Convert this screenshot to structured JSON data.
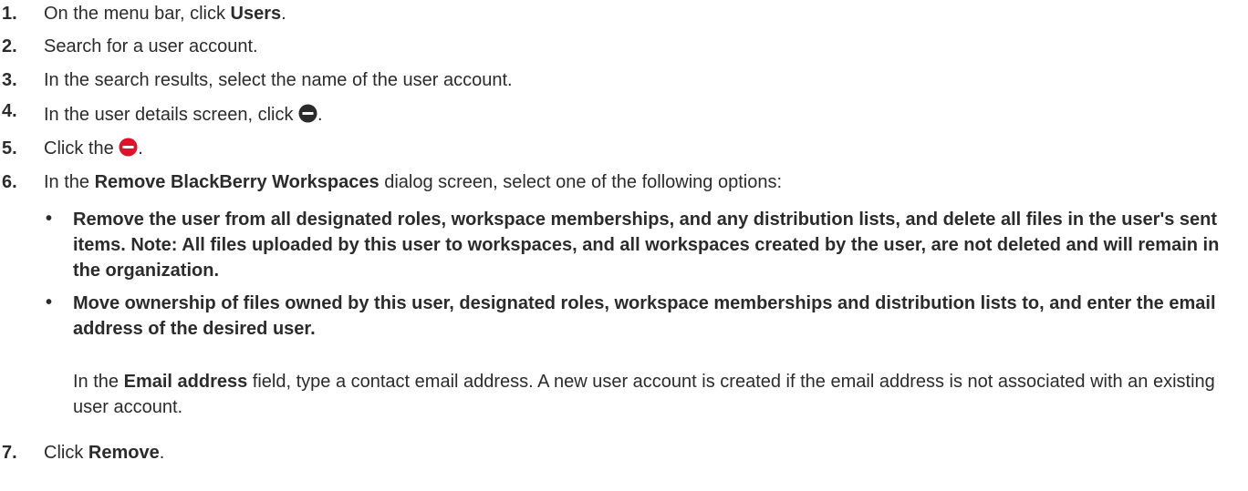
{
  "steps": [
    {
      "num": "1.",
      "pre": "On the menu bar, click ",
      "bold": "Users",
      "post": "."
    },
    {
      "num": "2.",
      "text": "Search for a user account."
    },
    {
      "num": "3.",
      "text": "In the search results, select the name of the user account."
    },
    {
      "num": "4.",
      "pre": "In the user details screen, click ",
      "post": "."
    },
    {
      "num": "5.",
      "pre": "Click the ",
      "post": "."
    },
    {
      "num": "6.",
      "pre": "In the ",
      "bold": "Remove BlackBerry Workspaces",
      "post": " dialog screen, select one of the following options:"
    },
    {
      "num": "7.",
      "pre": "Click ",
      "bold": "Remove",
      "post": "."
    }
  ],
  "options": [
    {
      "bullet": "•",
      "text": "Remove the user from all designated roles, workspace memberships, and any distribution lists, and delete all files in the user's sent items. Note: All files uploaded by this user to workspaces, and all workspaces created by the user, are not deleted and will remain in the organization."
    },
    {
      "bullet": "•",
      "text": "Move ownership of files owned by this user, designated roles, workspace memberships and distribution lists to, and enter the email address of the desired user."
    }
  ],
  "email_note": {
    "pre": "In the ",
    "bold": "Email address",
    "post": " field, type a contact email address. A new user account is created if the email address is not associated with an existing user account."
  },
  "icons": {
    "step4": "minus-circle-dark-icon",
    "step5": "minus-circle-red-icon"
  },
  "colors": {
    "text": "#2b2b2b",
    "dark_icon": "#2b2b2b",
    "red_icon": "#e0112b"
  }
}
